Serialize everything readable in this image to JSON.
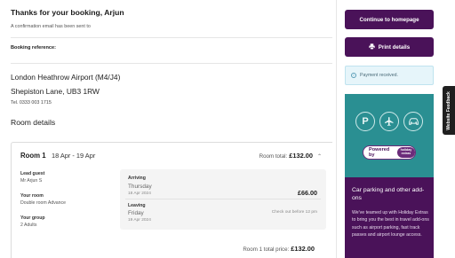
{
  "header": {
    "title": "Thanks for your booking, Arjun",
    "confirmation": "A confirmation email has been sent to"
  },
  "booking_reference_label": "Booking reference:",
  "location": {
    "line1": "London Heathrow Airport (M4/J4)",
    "line2": "Shepiston Lane, UB3 1RW",
    "tel": "Tel. 0333 003 1715"
  },
  "room_details_heading": "Room details",
  "room": {
    "name": "Room 1",
    "dates": "18 Apr - 19 Apr",
    "total_label": "Room total:",
    "total_amount": "£132.00",
    "lead_guest_label": "Lead guest",
    "lead_guest": "Mr Arjun S",
    "your_room_label": "Your room",
    "your_room": "Double room Advance",
    "your_group_label": "Your group",
    "your_group": "2 Adults",
    "arriving_label": "Arriving",
    "arriving_day": "Thursday",
    "arriving_date": "18 Apr 2024",
    "price": "£66.00",
    "leaving_label": "Leaving",
    "leaving_day": "Friday",
    "leaving_date": "19 Apr 2024",
    "checkout": "Check out before 12 pm",
    "room1_total_label": "Room 1 total price:",
    "room1_total_amount": "£132.00"
  },
  "sidebar": {
    "continue_label": "Continue to homepage",
    "print_label": "Print details",
    "payment_notice": "Payment received.",
    "powered_by": "Powered by",
    "brand_logo": "holiday extras",
    "promo_title": "Car parking and other add-ons",
    "promo_text": "We've teamed up with Holiday Extras to bring you the best in travel add-ons such as airport parking, fast track passes and airport lounge access."
  },
  "feedback_label": "Website Feedback",
  "colors": {
    "primary": "#4a1259",
    "teal": "#2a8f92",
    "notice_bg": "#e6f5fa"
  },
  "icons": [
    "printer-icon",
    "info-icon",
    "parking-icon",
    "plane-icon",
    "car-icon",
    "chevron-up-icon"
  ]
}
